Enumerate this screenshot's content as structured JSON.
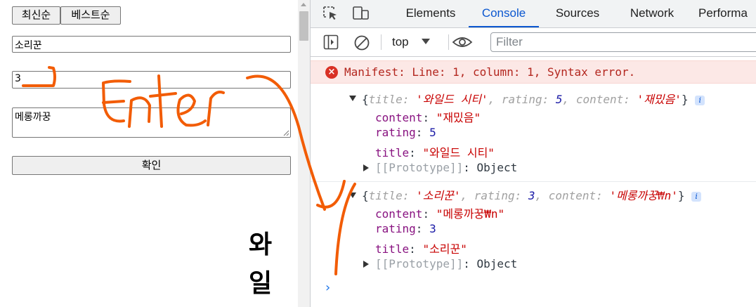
{
  "page": {
    "sort_buttons": [
      "최신순",
      "베스트순"
    ],
    "inputs": {
      "title_value": "소리꾼",
      "rating_value": "3",
      "content_value": "메롱까꿍"
    },
    "confirm_label": "확인",
    "big_text": [
      "와",
      "일"
    ]
  },
  "annotation": {
    "handwritten_text": "Enter",
    "stroke_color": "#f25c05"
  },
  "devtools": {
    "tabs": [
      "Elements",
      "Console",
      "Sources",
      "Network",
      "Performa"
    ],
    "active_tab": "Console",
    "context": "top",
    "filter_placeholder": "Filter",
    "error": {
      "icon": "×",
      "text": "Manifest: Line: 1, column: 1, Syntax error."
    },
    "logs": [
      {
        "preview": {
          "open": "{",
          "k1": "title",
          "v1": "'와일드 시티'",
          "k2": "rating",
          "v2": "5",
          "k3": "content",
          "v3": "'재밌음'",
          "close": "}"
        },
        "props": [
          {
            "key": "content",
            "value": "\"재밌음\""
          },
          {
            "key": "rating",
            "value": "5"
          },
          {
            "key": "title",
            "value": "\"와일드 시티\""
          }
        ],
        "proto_key": "[[Prototype]]",
        "proto_value": "Object"
      },
      {
        "preview": {
          "open": "{",
          "k1": "title",
          "v1": "'소리꾼'",
          "k2": "rating",
          "v2": "3",
          "k3": "content",
          "v3": "'메롱까꿍₩n'",
          "close": "}"
        },
        "props": [
          {
            "key": "content",
            "value": "\"메롱까꿍₩n\""
          },
          {
            "key": "rating",
            "value": "3"
          },
          {
            "key": "title",
            "value": "\"소리꾼\""
          }
        ],
        "proto_key": "[[Prototype]]",
        "proto_value": "Object"
      }
    ],
    "prompt_symbol": "›",
    "info_badge": "i",
    "colors": {
      "accent": "#0b57d0",
      "error_bg": "#fce8e6",
      "error_text": "#b3261e",
      "key": "#881280",
      "string": "#c80000",
      "number": "#1a1aa6"
    }
  }
}
